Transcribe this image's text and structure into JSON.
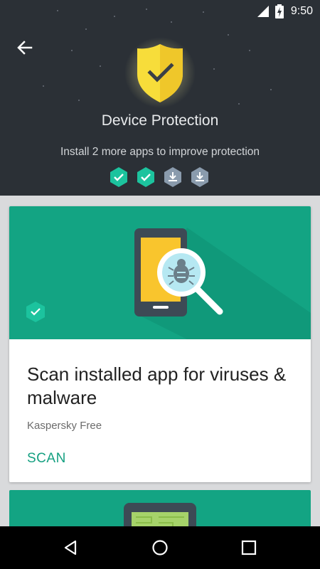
{
  "status_bar": {
    "time": "9:50"
  },
  "header": {
    "title": "Device Protection",
    "subtitle": "Install 2 more apps to improve protection",
    "badges": [
      "installed",
      "installed",
      "download",
      "download"
    ]
  },
  "card": {
    "title": "Scan installed app for viruses & malware",
    "subtitle": "Kaspersky Free",
    "action_label": "SCAN"
  },
  "colors": {
    "header_bg": "#2b3036",
    "accent_green": "#13a483",
    "shield_yellow": "#f5d634",
    "phone_body": "#3d4a55",
    "phone_screen": "#f9c52d"
  },
  "icons": {
    "back": "arrow-back-icon",
    "shield": "shield-check-icon",
    "nav": [
      "nav-back-icon",
      "nav-home-icon",
      "nav-recents-icon"
    ]
  }
}
